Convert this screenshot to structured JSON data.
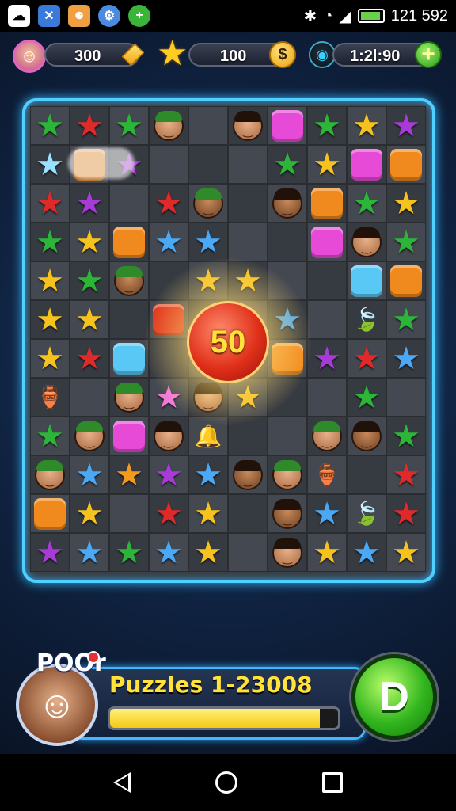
{
  "status_bar": {
    "app_icons": [
      "cloud-app-icon",
      "x-app-icon",
      "game-app-icon",
      "settings-app-icon",
      "plus-app-icon"
    ],
    "time": "121 592",
    "battery_level": 0.8
  },
  "hud": {
    "gems": "300",
    "stars": "100",
    "timer": "1:2l:90"
  },
  "combo": {
    "value": "50"
  },
  "player": {
    "rank": "POOr",
    "level_name": "Puzzles 1-23008",
    "progress": 0.92,
    "go_label": "D"
  },
  "board": {
    "rows": [
      [
        "star-green",
        "star-red",
        "star-green",
        "face",
        "empty",
        "face",
        "block-pink",
        "star-green",
        "star-yellow",
        "star-purple"
      ],
      [
        "star-blue-glow",
        "block-orange",
        "star-purple",
        "empty",
        "empty",
        "empty",
        "star-green",
        "star-yellow",
        "block-pink",
        "block-orange"
      ],
      [
        "star-red",
        "star-purple",
        "empty",
        "star-red",
        "face",
        "empty",
        "face",
        "block-orange",
        "star-green",
        "star-yellow"
      ],
      [
        "star-green",
        "star-yellow",
        "block-orange",
        "star-blue",
        "star-blue",
        "empty",
        "empty",
        "block-pink",
        "face",
        "star-green"
      ],
      [
        "star-yellow",
        "star-green",
        "face",
        "empty",
        "star-yellow",
        "star-yellow",
        "empty",
        "empty",
        "block-blue",
        "block-orange"
      ],
      [
        "star-yellow",
        "star-yellow",
        "empty",
        "block-red",
        "empty",
        "empty",
        "star-blue",
        "empty",
        "special-leaf",
        "star-green"
      ],
      [
        "star-yellow",
        "star-red",
        "block-blue",
        "empty",
        "empty",
        "empty",
        "block-orange",
        "star-purple",
        "star-red",
        "star-blue"
      ],
      [
        "special-pot",
        "empty",
        "face",
        "star-pink",
        "face",
        "star-yellow",
        "empty",
        "empty",
        "star-green",
        "empty"
      ],
      [
        "star-green",
        "face",
        "block-pink",
        "face",
        "special-bell",
        "empty",
        "empty",
        "face",
        "face",
        "star-green"
      ],
      [
        "face",
        "star-blue",
        "star-orange",
        "star-purple",
        "star-blue",
        "face",
        "face",
        "special-pot",
        "empty",
        "star-red"
      ],
      [
        "block-orange",
        "star-yellow",
        "empty",
        "star-red",
        "star-yellow",
        "empty",
        "face",
        "star-blue",
        "special-leaf",
        "star-red"
      ],
      [
        "star-purple",
        "star-blue",
        "star-green",
        "star-blue",
        "star-yellow",
        "empty",
        "face",
        "star-yellow",
        "star-blue",
        "star-yellow"
      ]
    ]
  },
  "colors": {
    "star-red": "#e02a2a",
    "star-green": "#2db53a",
    "star-yellow": "#f5c21e",
    "star-blue": "#4aa8f5",
    "star-purple": "#a83ad8",
    "star-orange": "#f09a1e",
    "star-pink": "#f07ad8",
    "star-blue-glow": "#9ae0ff",
    "block-orange": "#f08a1e",
    "block-pink": "#e84ad8",
    "block-blue": "#5ac8f5",
    "block-red": "#e0301a"
  }
}
